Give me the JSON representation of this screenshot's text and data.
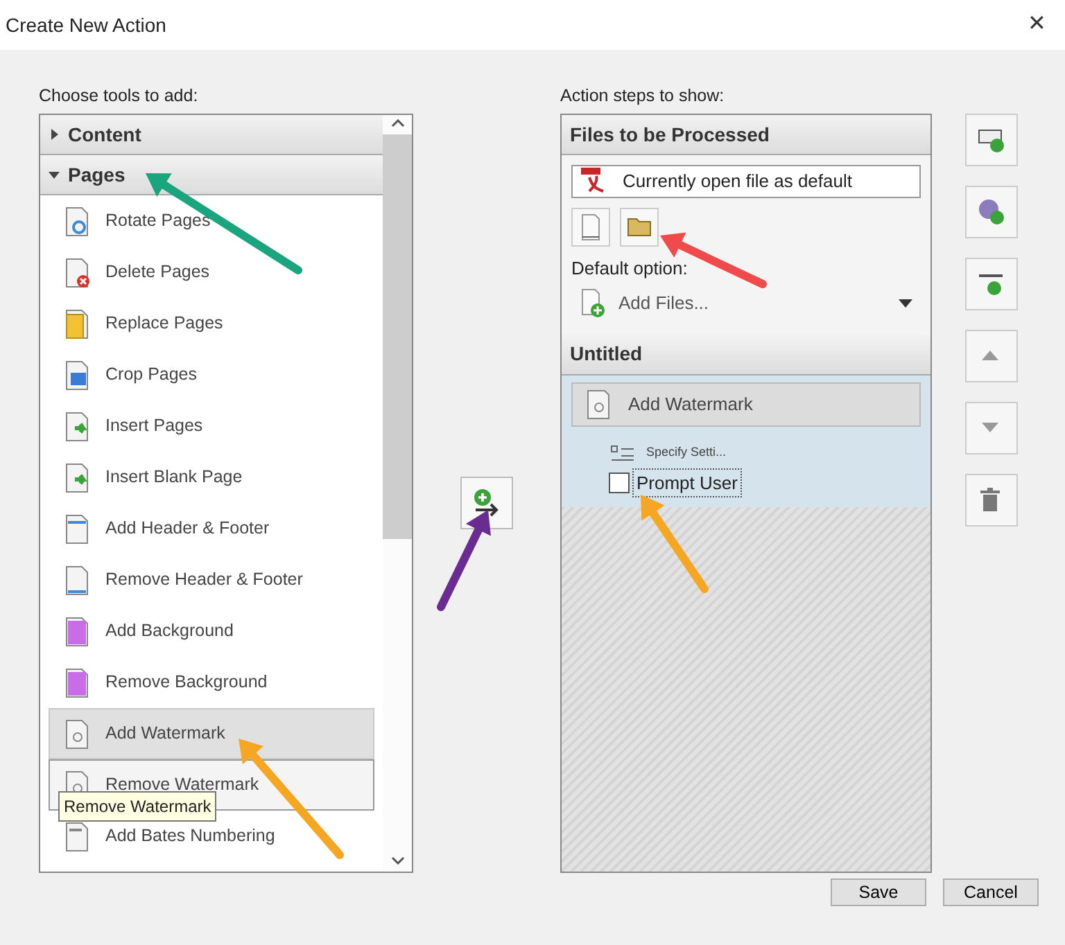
{
  "window": {
    "title": "Create New Action",
    "close_glyph": "✕"
  },
  "tools_panel": {
    "label": "Choose tools to add:",
    "groups": [
      {
        "label": "Content",
        "expanded": false
      },
      {
        "label": "Pages",
        "expanded": true
      }
    ],
    "items": [
      {
        "label": "Rotate Pages",
        "selected": false,
        "hovered": false
      },
      {
        "label": "Delete Pages",
        "selected": false,
        "hovered": false
      },
      {
        "label": "Replace Pages",
        "selected": false,
        "hovered": false
      },
      {
        "label": "Crop Pages",
        "selected": false,
        "hovered": false
      },
      {
        "label": "Insert Pages",
        "selected": false,
        "hovered": false
      },
      {
        "label": "Insert Blank Page",
        "selected": false,
        "hovered": false
      },
      {
        "label": "Add Header & Footer",
        "selected": false,
        "hovered": false
      },
      {
        "label": "Remove Header & Footer",
        "selected": false,
        "hovered": false
      },
      {
        "label": "Add Background",
        "selected": false,
        "hovered": false
      },
      {
        "label": "Remove Background",
        "selected": false,
        "hovered": false
      },
      {
        "label": "Add Watermark",
        "selected": true,
        "hovered": false
      },
      {
        "label": "Remove Watermark",
        "selected": false,
        "hovered": true
      },
      {
        "label": "Add Bates Numbering",
        "selected": false,
        "hovered": false
      }
    ],
    "tooltip": "Remove Watermark"
  },
  "steps_panel": {
    "label": "Action steps to show:",
    "files_section": {
      "title": "Files to be Processed",
      "file_value": "Currently open file as default",
      "default_label": "Default option:",
      "default_value": "Add Files..."
    },
    "step_section": {
      "title": "Untitled",
      "steps": [
        {
          "label": "Add Watermark",
          "setting": "Specify Setti...",
          "prompt_label": "Prompt User",
          "prompt_checked": false
        }
      ]
    }
  },
  "annotation_arrows": [
    {
      "color": "#1aa57f"
    },
    {
      "color": "#ef4b4b"
    },
    {
      "color": "#6a2c91"
    },
    {
      "color": "#f5a623"
    },
    {
      "color": "#f5a623"
    }
  ],
  "buttons": [
    "Save",
    "Cancel"
  ]
}
